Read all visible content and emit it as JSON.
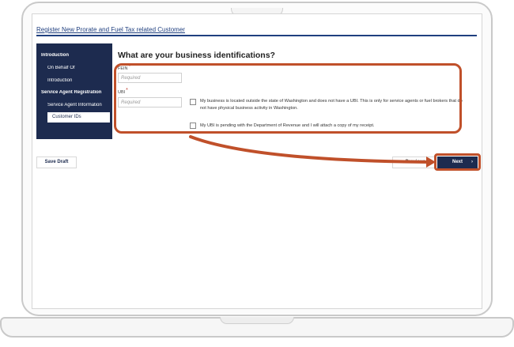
{
  "page": {
    "title": "Register New Prorate and Fuel Tax related Customer"
  },
  "nav": {
    "items": [
      {
        "label": "Introduction"
      },
      {
        "label": "On Behalf Of"
      },
      {
        "label": "Introduction"
      },
      {
        "label": "Service Agent Registration"
      },
      {
        "label": "Service Agent Information"
      },
      {
        "label": "Customer IDs"
      }
    ]
  },
  "form": {
    "heading": "What are your business identifications?",
    "fein_label": "FEIN",
    "fein_placeholder": "Required",
    "ubi_label": "UBI",
    "ubi_placeholder": "Required",
    "required_marker": "*",
    "checkbox1_text": "My business is located outside the state of Washington and does not have a UBI. This is only for service agents or fuel brokers that do not have physical business activity in Washington.",
    "checkbox2_text": "My UBI is pending with the Department of Revenue and I will attach a copy of my receipt."
  },
  "footer": {
    "save_label": "Save Draft",
    "prev_label": "Previous",
    "prev_icon": "‹",
    "next_label": "Next",
    "next_icon": "›"
  },
  "colors": {
    "highlight": "#c0502a",
    "nav_bg": "#1d2b4f",
    "title_link": "#1f3f7f"
  }
}
